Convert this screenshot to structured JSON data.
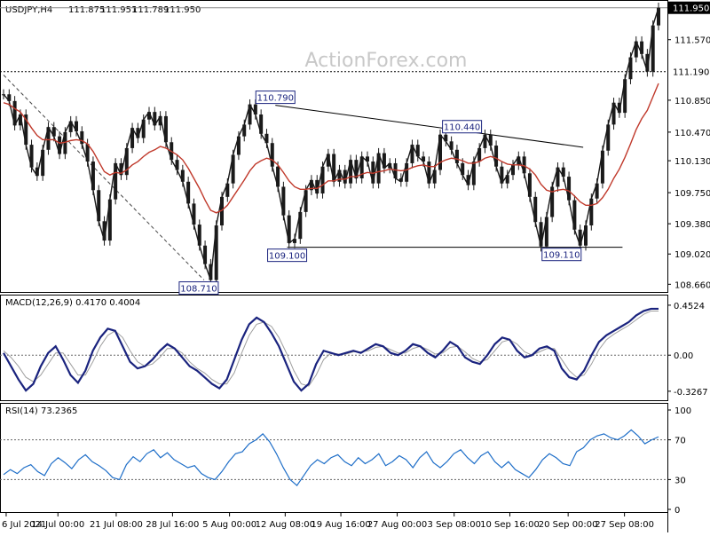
{
  "chart_data": {
    "type": "candlestick",
    "symbol_header": "USDJPY,H4",
    "ohlc_header": [
      "111.875",
      "111.951",
      "111.789",
      "111.950"
    ],
    "watermark": "ActionForex.com",
    "colors": {
      "price": "#1a1a1a",
      "ma": "#c0392b",
      "macd": "#1a237e",
      "signal": "#9e9e9e",
      "rsi": "#1e6ec8",
      "label_border": "#1a237e"
    },
    "x_ticks": [
      "6 Jul 2021",
      "14 Jul 00:00",
      "21 Jul 08:00",
      "28 Jul 16:00",
      "5 Aug 00:00",
      "12 Aug 08:00",
      "19 Aug 16:00",
      "27 Aug 00:00",
      "3 Sep 08:00",
      "10 Sep 16:00",
      "20 Sep 00:00",
      "27 Sep 08:00"
    ],
    "price_panel": {
      "y_ticks": [
        "111.570",
        "111.190",
        "110.850",
        "110.470",
        "110.130",
        "109.750",
        "109.380",
        "109.020",
        "108.660"
      ],
      "ylim": [
        108.6,
        112.0
      ],
      "current_label": "111.950",
      "current_value": 111.95,
      "level_value": 111.19,
      "level_label": "111.190",
      "pivot_labels": [
        {
          "text": "110.790",
          "value": 110.79,
          "t": 0.415
        },
        {
          "text": "110.440",
          "value": 110.44,
          "t": 0.7
        },
        {
          "text": "109.100",
          "value": 109.1,
          "t": 0.433
        },
        {
          "text": "109.110",
          "value": 109.11,
          "t": 0.852
        },
        {
          "text": "108.710",
          "value": 108.71,
          "t": 0.298
        }
      ],
      "close": [
        110.92,
        110.84,
        110.55,
        110.68,
        110.32,
        110.05,
        109.95,
        110.26,
        110.53,
        110.42,
        110.21,
        110.47,
        110.6,
        110.48,
        110.33,
        110.12,
        109.78,
        109.41,
        109.18,
        109.67,
        110.1,
        109.96,
        110.28,
        110.52,
        110.4,
        110.62,
        110.71,
        110.55,
        110.66,
        110.35,
        110.14,
        110.02,
        109.88,
        109.62,
        109.37,
        109.12,
        108.9,
        108.71,
        109.36,
        109.7,
        109.86,
        110.2,
        110.42,
        110.56,
        110.8,
        110.68,
        110.45,
        110.34,
        110.06,
        109.82,
        109.48,
        109.15,
        109.2,
        109.52,
        109.78,
        109.9,
        109.74,
        110.06,
        110.21,
        109.88,
        110.02,
        109.86,
        110.14,
        109.92,
        110.18,
        110.12,
        109.86,
        110.22,
        110.04,
        110.1,
        109.92,
        109.88,
        110.1,
        110.32,
        110.18,
        110.12,
        109.86,
        110.02,
        110.44,
        110.36,
        110.26,
        110.1,
        109.96,
        109.84,
        110.12,
        110.28,
        110.44,
        110.31,
        110.06,
        109.86,
        109.96,
        110.08,
        110.18,
        109.98,
        109.7,
        109.4,
        109.11,
        109.46,
        109.82,
        110.05,
        109.94,
        109.66,
        109.31,
        109.12,
        109.36,
        109.68,
        109.86,
        110.25,
        110.56,
        110.82,
        110.7,
        111.1,
        111.36,
        111.55,
        111.4,
        111.19,
        111.74,
        111.95
      ],
      "ma": [
        110.82,
        110.8,
        110.75,
        110.71,
        110.62,
        110.52,
        110.43,
        110.38,
        110.38,
        110.38,
        110.34,
        110.35,
        110.37,
        110.38,
        110.37,
        110.33,
        110.24,
        110.12,
        110.0,
        109.96,
        109.99,
        109.98,
        110.02,
        110.08,
        110.12,
        110.18,
        110.23,
        110.26,
        110.3,
        110.28,
        110.24,
        110.2,
        110.14,
        110.04,
        109.92,
        109.8,
        109.66,
        109.54,
        109.51,
        109.54,
        109.6,
        109.7,
        109.8,
        109.9,
        110.01,
        110.09,
        110.13,
        110.16,
        110.14,
        110.08,
        109.99,
        109.89,
        109.82,
        109.79,
        109.79,
        109.8,
        109.8,
        109.84,
        109.89,
        109.89,
        109.91,
        109.91,
        109.94,
        109.94,
        109.97,
        109.99,
        109.98,
        110.0,
        110.01,
        110.03,
        110.02,
        110.01,
        110.02,
        110.05,
        110.07,
        110.08,
        110.06,
        110.06,
        110.11,
        110.14,
        110.16,
        110.15,
        110.13,
        110.1,
        110.1,
        110.12,
        110.16,
        110.18,
        110.16,
        110.12,
        110.09,
        110.08,
        110.08,
        110.07,
        110.03,
        109.96,
        109.85,
        109.78,
        109.76,
        109.78,
        109.79,
        109.77,
        109.71,
        109.64,
        109.6,
        109.6,
        109.62,
        109.69,
        109.79,
        109.92,
        110.03,
        110.17,
        110.33,
        110.5,
        110.63,
        110.73,
        110.89,
        111.05
      ]
    },
    "macd_panel": {
      "label": "MACD(12,26,9) 0.4170 0.4004",
      "y_ticks": [
        "0.4524",
        "0.00",
        "-0.3267"
      ],
      "ylim": [
        -0.4,
        0.5
      ],
      "macd": [
        0.02,
        -0.1,
        -0.22,
        -0.32,
        -0.26,
        -0.1,
        0.02,
        0.08,
        -0.04,
        -0.18,
        -0.25,
        -0.14,
        0.04,
        0.16,
        0.24,
        0.22,
        0.08,
        -0.06,
        -0.12,
        -0.1,
        -0.04,
        0.04,
        0.1,
        0.06,
        -0.02,
        -0.1,
        -0.14,
        -0.2,
        -0.26,
        -0.3,
        -0.22,
        -0.04,
        0.14,
        0.28,
        0.34,
        0.3,
        0.2,
        0.08,
        -0.08,
        -0.24,
        -0.32,
        -0.26,
        -0.08,
        0.04,
        0.02,
        0.0,
        0.02,
        0.04,
        0.02,
        0.06,
        0.1,
        0.08,
        0.02,
        0.0,
        0.04,
        0.1,
        0.08,
        0.02,
        -0.02,
        0.04,
        0.12,
        0.08,
        -0.02,
        -0.06,
        -0.08,
        0.0,
        0.1,
        0.16,
        0.14,
        0.04,
        -0.02,
        0.0,
        0.06,
        0.08,
        0.04,
        -0.12,
        -0.2,
        -0.22,
        -0.14,
        0.0,
        0.12,
        0.18,
        0.22,
        0.26,
        0.3,
        0.36,
        0.4,
        0.42,
        0.42
      ],
      "signal": [
        0.04,
        -0.02,
        -0.1,
        -0.2,
        -0.24,
        -0.18,
        -0.08,
        0.02,
        0.02,
        -0.08,
        -0.18,
        -0.18,
        -0.06,
        0.08,
        0.18,
        0.22,
        0.16,
        0.04,
        -0.06,
        -0.1,
        -0.08,
        -0.02,
        0.06,
        0.06,
        0.02,
        -0.06,
        -0.12,
        -0.16,
        -0.22,
        -0.26,
        -0.26,
        -0.16,
        0.02,
        0.18,
        0.28,
        0.3,
        0.26,
        0.16,
        0.02,
        -0.14,
        -0.26,
        -0.28,
        -0.18,
        -0.04,
        0.02,
        0.01,
        0.01,
        0.03,
        0.03,
        0.04,
        0.07,
        0.08,
        0.05,
        0.02,
        0.02,
        0.06,
        0.08,
        0.05,
        0.01,
        0.02,
        0.07,
        0.08,
        0.03,
        -0.03,
        -0.06,
        -0.04,
        0.04,
        0.12,
        0.14,
        0.1,
        0.03,
        0.0,
        0.03,
        0.06,
        0.06,
        -0.04,
        -0.14,
        -0.2,
        -0.18,
        -0.08,
        0.05,
        0.14,
        0.19,
        0.23,
        0.27,
        0.32,
        0.37,
        0.4,
        0.4
      ]
    },
    "rsi_panel": {
      "label": "RSI(14) 73.2365",
      "y_ticks": [
        "100",
        "70",
        "30",
        "0"
      ],
      "ylim": [
        0,
        100
      ],
      "levels": [
        70,
        30
      ],
      "values": [
        35,
        40,
        36,
        42,
        45,
        38,
        34,
        46,
        52,
        47,
        41,
        50,
        55,
        48,
        44,
        39,
        32,
        30,
        45,
        53,
        48,
        56,
        60,
        52,
        57,
        50,
        46,
        42,
        44,
        36,
        32,
        30,
        38,
        48,
        56,
        58,
        66,
        70,
        76,
        68,
        56,
        42,
        30,
        24,
        34,
        44,
        50,
        46,
        52,
        55,
        48,
        44,
        52,
        46,
        50,
        56,
        44,
        48,
        54,
        50,
        42,
        52,
        58,
        47,
        42,
        48,
        56,
        60,
        52,
        46,
        54,
        58,
        48,
        42,
        48,
        40,
        36,
        32,
        40,
        50,
        56,
        52,
        46,
        44,
        58,
        62,
        70,
        74,
        76,
        72,
        70,
        74,
        80,
        74,
        66,
        70,
        73
      ]
    }
  }
}
